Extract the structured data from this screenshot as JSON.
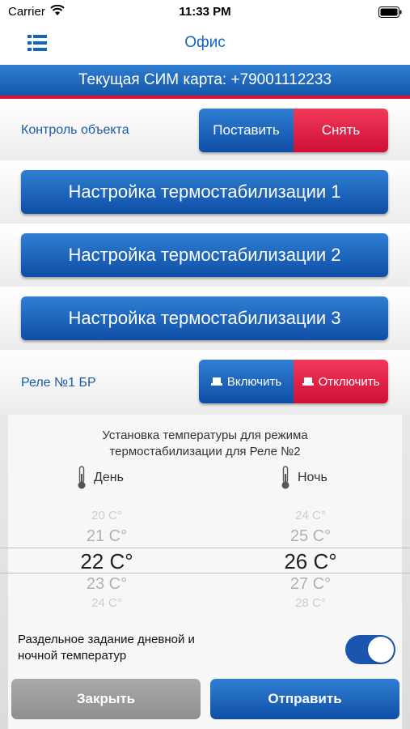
{
  "status_bar": {
    "carrier": "Carrier",
    "time": "11:33 PM",
    "icons": [
      "wifi-icon",
      "battery-icon"
    ]
  },
  "nav": {
    "title": "Офис",
    "menu_icon": "list-menu-icon"
  },
  "sim_banner": {
    "text": "Текущая СИМ карта: +79001112233"
  },
  "object_control": {
    "label": "Контроль объекта",
    "arm_label": "Поставить",
    "disarm_label": "Снять"
  },
  "thermo_buttons": [
    {
      "label": "Настройка термостабилизации 1"
    },
    {
      "label": "Настройка термостабилизации 2"
    },
    {
      "label": "Настройка термостабилизации 3"
    }
  ],
  "relay": {
    "label": "Реле №1 БР",
    "on_label": "Включить",
    "off_label": "Отключить"
  },
  "sheet": {
    "title_line1": "Установка температуры для режима",
    "title_line2": "термостабилизации для Реле №2",
    "day_label": "День",
    "night_label": "Ночь",
    "day_options": [
      "20 C°",
      "21 C°",
      "22 C°",
      "23 C°",
      "24 C°"
    ],
    "night_options": [
      "24 C°",
      "25 C°",
      "26 C°",
      "27 C°",
      "28 C°"
    ],
    "day_selected": "22 C°",
    "night_selected": "26 C°",
    "toggle_line1": "Раздельное задание дневной и",
    "toggle_line2": "ночной температур",
    "toggle_on": true,
    "close_label": "Закрыть",
    "send_label": "Отправить"
  },
  "colors": {
    "accent_blue": "#1565c0",
    "danger_red": "#d7143a",
    "toggle": "#1a56b0"
  }
}
